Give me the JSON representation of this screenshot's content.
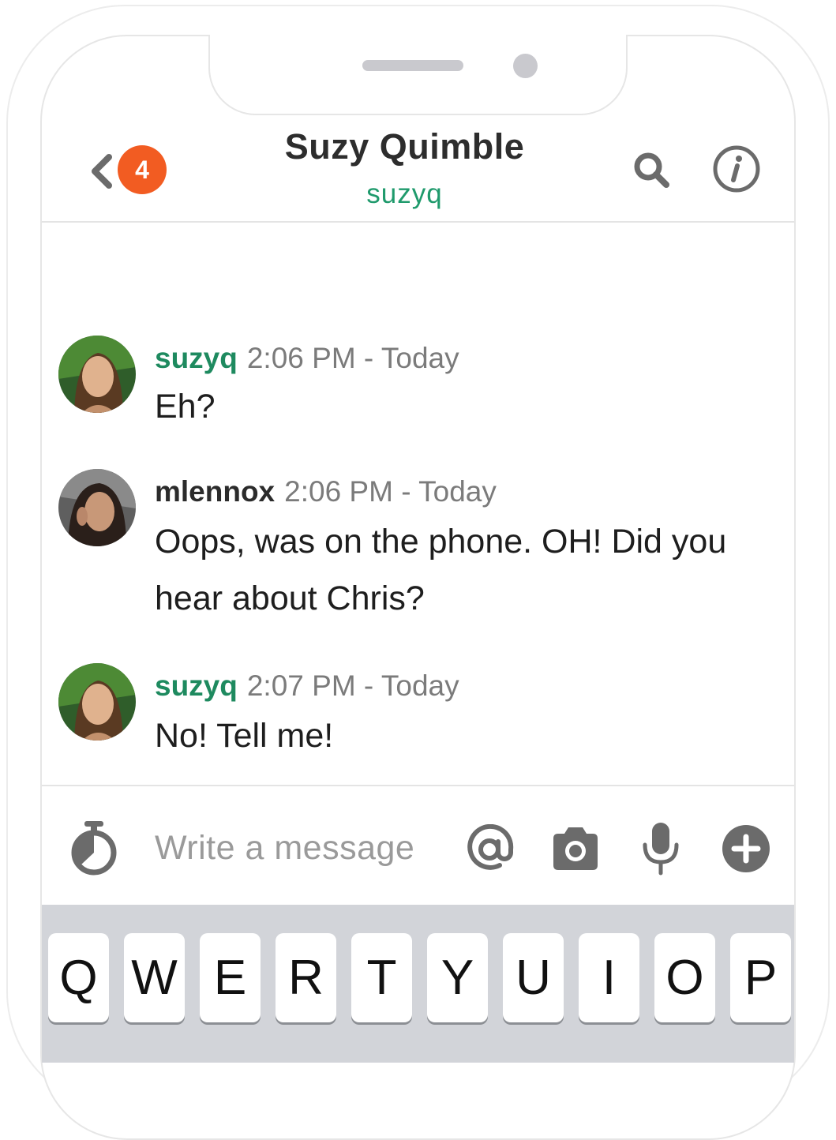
{
  "header": {
    "unread_count": "4",
    "title": "Suzy Quimble",
    "subtitle": "suzyq"
  },
  "messages": [
    {
      "user": "suzyq",
      "time": "2:06 PM - Today",
      "text": "Eh?"
    },
    {
      "user": "mlennox",
      "time": "2:06 PM - Today",
      "text": "Oops, was on the phone. OH!  Did you hear about Chris?"
    },
    {
      "user": "suzyq",
      "time": "2:07 PM - Today",
      "text": "No! Tell me!"
    }
  ],
  "composer": {
    "placeholder": "Write a message"
  },
  "keyboard": {
    "row1": [
      "Q",
      "W",
      "E",
      "R",
      "T",
      "Y",
      "U",
      "I",
      "O",
      "P"
    ]
  },
  "colors": {
    "accent_green": "#1e8a5f",
    "badge_orange": "#f25c22",
    "icon_gray": "#6b6b6b"
  },
  "icons": [
    "back-chevron-icon",
    "search-icon",
    "info-icon",
    "timer-icon",
    "at-icon",
    "camera-icon",
    "microphone-icon",
    "plus-icon"
  ]
}
